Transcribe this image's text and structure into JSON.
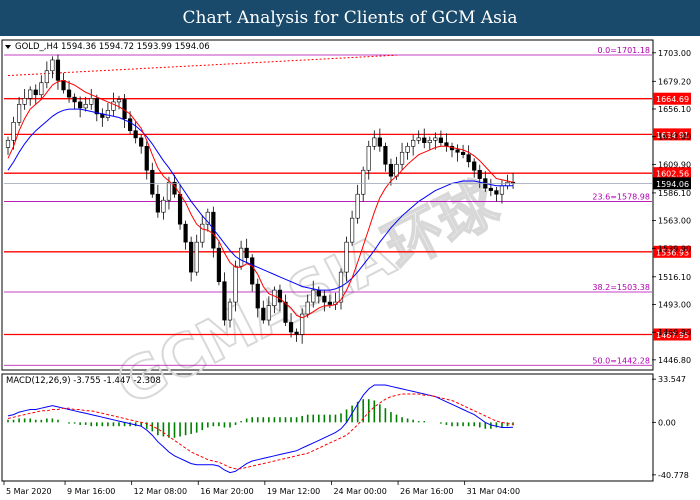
{
  "banner": {
    "title": "Chart Analysis for Clients of GCM Asia"
  },
  "watermark": "GCMASIA环球",
  "colors": {
    "bull": "#008000",
    "bear": "#000000",
    "ma_fast": "#ff0000",
    "ma_slow": "#0000ff",
    "hline_red": "#ff0000",
    "fib": "#b000b0",
    "macd_line": "#0000ff",
    "macd_signal": "#ff0000",
    "macd_hist": "#008000"
  },
  "chart_data": [
    {
      "type": "candlestick",
      "header": "GOLD_,H4  1594.36 1594.72 1593.99 1594.06",
      "last_price": 1594.06,
      "last_price_label": "1594.06",
      "ylim": [
        1440,
        1712
      ],
      "y_ticks": [
        "1703.00",
        "1679.20",
        "1656.10",
        "1633.00",
        "1609.90",
        "1586.10",
        "1563.00",
        "1539.90",
        "1516.10",
        "1493.00",
        "1469.90",
        "1446.80"
      ],
      "x_ticks": [
        "5 Mar 2020",
        "9 Mar 16:00",
        "12 Mar 08:00",
        "16 Mar 20:00",
        "19 Mar 12:00",
        "24 Mar 00:00",
        "26 Mar 16:00",
        "31 Mar 04:00"
      ],
      "horizontal_levels": [
        {
          "value": 1664.69,
          "label": "1664.69",
          "style": "red"
        },
        {
          "value": 1634.91,
          "label": "1634.91",
          "style": "red"
        },
        {
          "value": 1602.56,
          "label": "1602.56",
          "style": "red"
        },
        {
          "value": 1536.93,
          "label": "1536.93",
          "style": "red"
        },
        {
          "value": 1467.95,
          "label": "1467.95",
          "style": "red"
        }
      ],
      "fib_levels": [
        {
          "value": 1701.18,
          "label": "0.0=1701.18"
        },
        {
          "value": 1578.98,
          "label": "23.6=1578.98"
        },
        {
          "value": 1503.38,
          "label": "38.2=1503.38"
        },
        {
          "value": 1442.28,
          "label": "50.0=1442.28"
        }
      ],
      "trendline": {
        "from": [
          0,
          1684
        ],
        "to": [
          70,
          1701
        ]
      },
      "closes": [
        1630,
        1645,
        1660,
        1665,
        1672,
        1668,
        1678,
        1688,
        1697,
        1680,
        1672,
        1666,
        1662,
        1657,
        1660,
        1665,
        1652,
        1649,
        1655,
        1662,
        1664,
        1648,
        1638,
        1632,
        1625,
        1605,
        1585,
        1570,
        1580,
        1595,
        1585,
        1560,
        1545,
        1520,
        1545,
        1560,
        1570,
        1540,
        1512,
        1480,
        1495,
        1525,
        1540,
        1532,
        1510,
        1490,
        1480,
        1492,
        1505,
        1495,
        1478,
        1470,
        1468,
        1485,
        1495,
        1505,
        1500,
        1495,
        1493,
        1495,
        1520,
        1545,
        1565,
        1585,
        1605,
        1625,
        1632,
        1625,
        1610,
        1600,
        1610,
        1620,
        1625,
        1630,
        1632,
        1628,
        1630,
        1632,
        1628,
        1625,
        1622,
        1620,
        1618,
        1612,
        1605,
        1598,
        1590,
        1588,
        1585,
        1592,
        1595,
        1594.06
      ],
      "ma_fast": [
        1615,
        1625,
        1638,
        1648,
        1656,
        1660,
        1664,
        1670,
        1676,
        1679,
        1680,
        1678,
        1676,
        1673,
        1670,
        1668,
        1666,
        1664,
        1662,
        1660,
        1658,
        1655,
        1652,
        1646,
        1640,
        1630,
        1618,
        1607,
        1600,
        1596,
        1592,
        1585,
        1578,
        1568,
        1560,
        1556,
        1555,
        1552,
        1546,
        1536,
        1528,
        1524,
        1524,
        1527,
        1525,
        1518,
        1508,
        1502,
        1500,
        1498,
        1494,
        1490,
        1484,
        1482,
        1484,
        1487,
        1490,
        1492,
        1492,
        1493,
        1497,
        1505,
        1515,
        1528,
        1542,
        1556,
        1570,
        1582,
        1590,
        1596,
        1600,
        1605,
        1610,
        1614,
        1618,
        1620,
        1622,
        1624,
        1625,
        1625,
        1624,
        1623,
        1622,
        1620,
        1617,
        1613,
        1608,
        1603,
        1598,
        1597,
        1596,
        1595
      ],
      "ma_slow": [
        1605,
        1612,
        1620,
        1627,
        1633,
        1638,
        1642,
        1646,
        1650,
        1653,
        1655,
        1656,
        1656,
        1656,
        1655,
        1654,
        1653,
        1652,
        1651,
        1650,
        1649,
        1647,
        1645,
        1642,
        1638,
        1633,
        1627,
        1620,
        1613,
        1607,
        1600,
        1593,
        1586,
        1579,
        1573,
        1567,
        1562,
        1556,
        1550,
        1544,
        1538,
        1533,
        1530,
        1528,
        1526,
        1524,
        1522,
        1520,
        1518,
        1516,
        1514,
        1512,
        1510,
        1508,
        1507,
        1506,
        1505,
        1505,
        1505,
        1506,
        1508,
        1511,
        1515,
        1520,
        1526,
        1532,
        1538,
        1545,
        1551,
        1557,
        1562,
        1567,
        1571,
        1575,
        1579,
        1582,
        1585,
        1588,
        1590,
        1592,
        1594,
        1595,
        1596,
        1596,
        1596,
        1595,
        1594,
        1593,
        1592,
        1592,
        1592,
        1592
      ]
    },
    {
      "type": "macd",
      "label": "MACD(12,26,9) -3.755 -1.447 -2.308",
      "ylim": [
        -44,
        36
      ],
      "y_ticks": [
        "33.547",
        "0.00",
        "-40.778"
      ],
      "y_tick_values": [
        33.547,
        0,
        -40.778
      ],
      "macd": [
        5,
        6,
        8,
        9,
        10,
        10,
        11,
        12,
        13,
        12,
        11,
        10,
        9,
        8,
        7,
        6,
        5,
        4,
        3,
        2,
        1,
        0,
        -1,
        -2,
        -3,
        -6,
        -10,
        -15,
        -19,
        -23,
        -26,
        -28,
        -30,
        -32,
        -33,
        -33,
        -33,
        -33,
        -34,
        -37,
        -39,
        -38,
        -35,
        -32,
        -30,
        -29,
        -28,
        -27,
        -26,
        -25,
        -24,
        -23,
        -22,
        -20,
        -18,
        -16,
        -14,
        -12,
        -10,
        -8,
        -5,
        0,
        7,
        14,
        21,
        26,
        29,
        29,
        29,
        28,
        27,
        26,
        25,
        24,
        23,
        22,
        21,
        20,
        18,
        16,
        14,
        12,
        10,
        8,
        6,
        3,
        0,
        -2,
        -3,
        -4,
        -4,
        -3.755
      ],
      "signal": [
        3,
        4,
        5,
        6,
        7,
        8,
        9,
        9,
        10,
        10,
        11,
        11,
        10,
        10,
        9,
        9,
        8,
        7,
        6,
        5,
        4,
        3,
        2,
        1,
        0,
        -1,
        -3,
        -5,
        -8,
        -11,
        -14,
        -17,
        -20,
        -23,
        -25,
        -27,
        -29,
        -30,
        -31,
        -33,
        -35,
        -36,
        -36,
        -35,
        -34,
        -33,
        -32,
        -31,
        -30,
        -29,
        -28,
        -27,
        -26,
        -25,
        -24,
        -22,
        -20,
        -18,
        -16,
        -14,
        -12,
        -10,
        -6,
        -2,
        3,
        8,
        12,
        15,
        18,
        20,
        21,
        22,
        22,
        22,
        22,
        21,
        21,
        20,
        19,
        18,
        17,
        15,
        13,
        11,
        9,
        7,
        5,
        3,
        1,
        0,
        -1,
        -1.447
      ]
    }
  ]
}
